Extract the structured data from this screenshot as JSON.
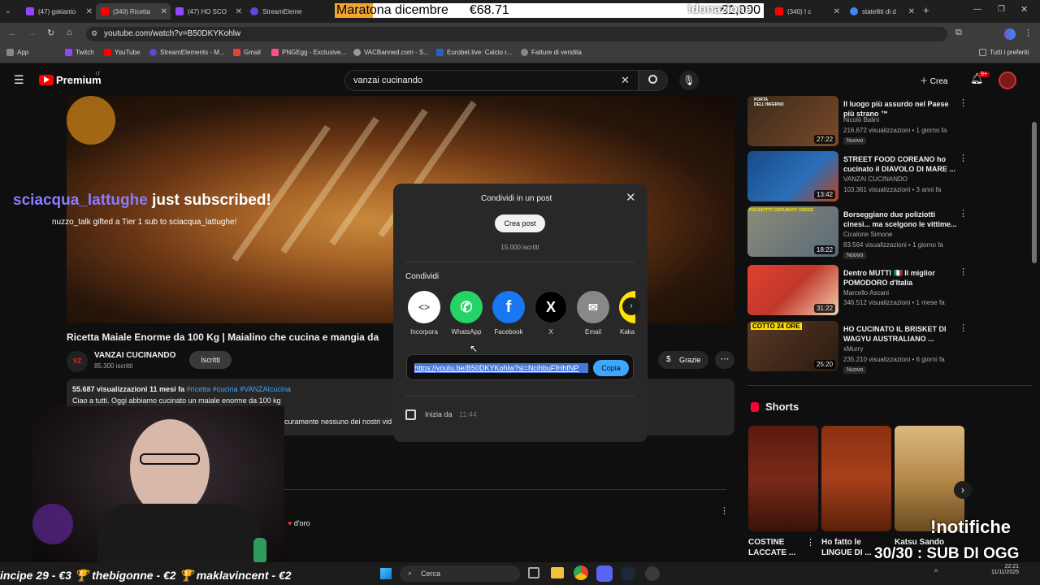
{
  "tabs": [
    {
      "label": "(47) gskianto",
      "color": "#9146ff"
    },
    {
      "label": "(340) Ricetta",
      "color": "#ff0000"
    },
    {
      "label": "(47) HO SCO",
      "color": "#9146ff"
    },
    {
      "label": "StreamEleme",
      "color": "#5a4bd6"
    }
  ],
  "tabs_right": [
    {
      "label": "(340) I c",
      "color": "#ff0000"
    },
    {
      "label": "statelliti di d",
      "color": "#4285f4"
    }
  ],
  "donation": {
    "title": "Maratona dicembre",
    "current": "€68.71",
    "goal": "€1,000",
    "command": "!donazione",
    "fill": 0.0687
  },
  "address": {
    "url": "youtube.com/watch?v=B50DKYKohlw"
  },
  "bookmarks": [
    {
      "label": "App",
      "color": "#888"
    },
    {
      "label": "Twitch",
      "color": "#9146ff"
    },
    {
      "label": "YouTube",
      "color": "#ff0000"
    },
    {
      "label": "StreamElements - M...",
      "color": "#5a4bd6"
    },
    {
      "label": "Gmail",
      "color": "#ea4335"
    },
    {
      "label": "PNGEgg - Exclusive...",
      "color": "#ff4f81"
    },
    {
      "label": "VACBanned.com - S...",
      "color": "#999"
    },
    {
      "label": "Eurobet.live: Calcio r...",
      "color": "#2463c7"
    },
    {
      "label": "Fatture di vendita",
      "color": "#888"
    }
  ],
  "bookmarks_all": "Tutti i preferiti",
  "yt": {
    "logo": "Premium",
    "logo_sup": "IT",
    "search_value": "vanzai cucinando",
    "create_label": "Crea",
    "notif_badge": "9+"
  },
  "video": {
    "title": "Ricetta Maiale Enorme da 100 Kg | Maialino che cucina e mangia da",
    "channel": "VANZAI CUCINANDO",
    "channel_badge": "VZ",
    "subscribers": "85.300 iscritti",
    "subscribe_label": "Iscritti",
    "thanks_label": "Grazie",
    "views_date": "55.687 visualizzazioni  11 mesi fa",
    "hashtags": "#ricetta #cucina #VANZAIcucina",
    "description": "Ciao a tutti. Oggi abbiamo cucinato un maiale enorme da 100 kg",
    "description_more": "curamente nessuno dei nostri vid",
    "comment_snippet": "d'oro"
  },
  "alerts": {
    "sub_user": "sciacqua_lattughe",
    "sub_text": "just subscribed!",
    "gift_text": "nuzzo_talk gifted a Tier 1 sub to sciacqua_lattughe!"
  },
  "modal": {
    "title": "Condividi in un post",
    "create_post": "Crea post",
    "subs": "15.000 iscritti",
    "share_heading": "Condividi",
    "share_items": [
      {
        "label": "Incorpora",
        "color": "#ffffff",
        "glyph": "<>"
      },
      {
        "label": "WhatsApp",
        "color": "#25d366",
        "glyph": "✆"
      },
      {
        "label": "Facebook",
        "color": "#1877f2",
        "glyph": "f"
      },
      {
        "label": "X",
        "color": "#000000",
        "glyph": "X"
      },
      {
        "label": "Email",
        "color": "#888888",
        "glyph": "✉"
      },
      {
        "label": "Kaka",
        "color": "#fee500",
        "glyph": ""
      }
    ],
    "link": "https://youtu.be/B50DKYKohlw?si=NcihbuFfHhfNP",
    "copy_label": "Copia",
    "start_at_label": "Inizia da",
    "start_at_time": "11:44"
  },
  "related": [
    {
      "title": "Il luogo più assurdo nel Paese più strano ™",
      "channel": "Nicolò Balini",
      "stats": "216.672 visualizzazioni • 1 giorno fa",
      "duration": "27:22",
      "badge": "Nuovo",
      "thumb": "#7a4a2a",
      "thumb_text": "PORTA DELL'INFERNO"
    },
    {
      "title": "STREET FOOD COREANO ho cucinato il DIAVOLO DI MARE ...",
      "channel": "VANZAI CUCINANDO",
      "stats": "103.361 visualizzazioni • 3 anni fa",
      "duration": "13:42",
      "badge": "",
      "thumb": "#2a6fb8",
      "thumb_text": ""
    },
    {
      "title": "Borseggiano due poliziotti cinesi... ma scelgono le vittime...",
      "channel": "Cicalone Simone",
      "stats": "83.564 visualizzazioni • 1 giorno fa",
      "duration": "18:22",
      "badge": "Nuovo",
      "thumb": "#8a8c78",
      "thumb_text": "POLIZIOTTO DERUBATO CINESE"
    },
    {
      "title": "Dentro MUTTI 🇮🇹 Il miglior POMODORO d'Italia",
      "channel": "Marcello Ascani",
      "stats": "346.512 visualizzazioni • 1 mese fa",
      "duration": "31:22",
      "badge": "",
      "thumb": "#c0392b",
      "thumb_text": ""
    },
    {
      "title": "HO CUCINATO IL BRISKET DI WAGYU AUSTRALIANO ...",
      "channel": "xMurry",
      "stats": "235.210 visualizzazioni • 6 giorni fa",
      "duration": "25:20",
      "badge": "Nuovo",
      "thumb": "#5a3a24",
      "thumb_text": "COTTO 24 ORE"
    }
  ],
  "shorts": {
    "heading": "Shorts",
    "items": [
      {
        "title": "COSTINE LACCATE ...",
        "color": "#7a2a18"
      },
      {
        "title": "Ho fatto le LINGUE DI ...",
        "color": "#a8401c"
      },
      {
        "title": "Katsu Sando",
        "color": "#b58a4a"
      }
    ]
  },
  "stream": {
    "notifiche": "!notifiche",
    "subgoal": "30/30 : SUB DI OGG",
    "ticker": "incipe 29 - €3    🏆 thebigonne - €2    🏆 maklavincent - €2"
  },
  "taskbar": {
    "search": "Cerca",
    "time": "22:21",
    "date": "11/11/2025"
  }
}
